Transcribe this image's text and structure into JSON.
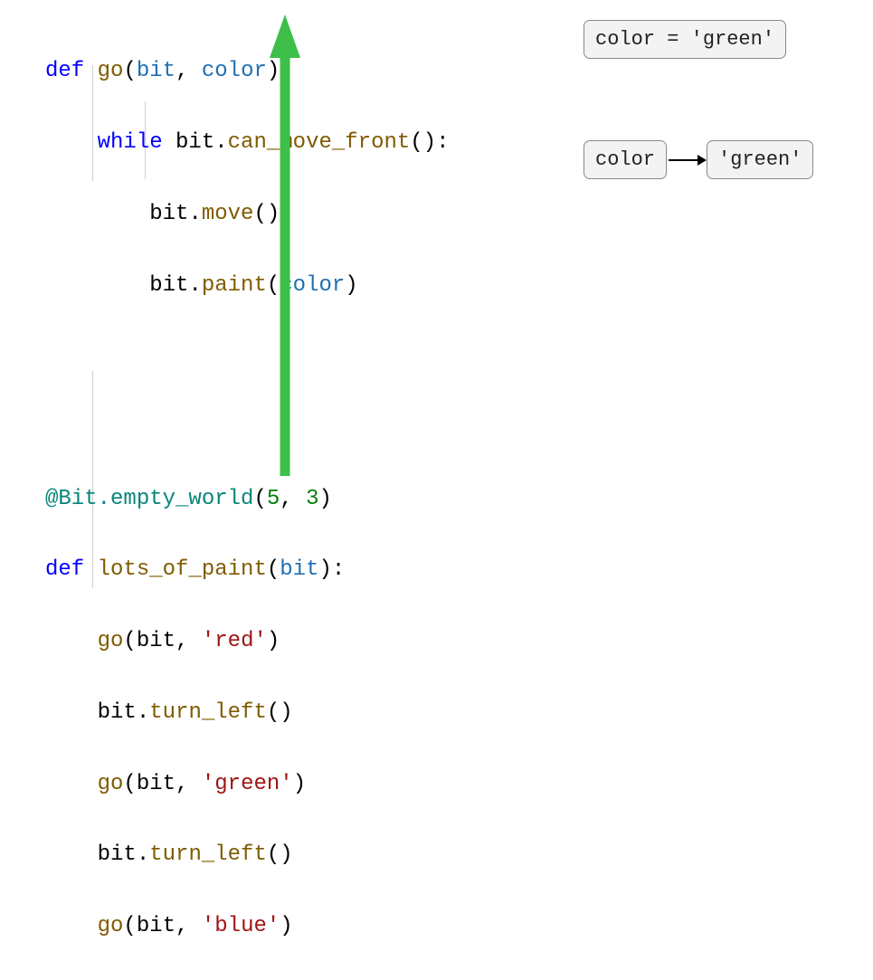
{
  "code": {
    "l1": {
      "def": "def",
      "fn": "go",
      "p1": "bit",
      "p2": "color"
    },
    "l2": {
      "kw": "while",
      "obj": "bit",
      "method": "can_move_front"
    },
    "l3": {
      "obj": "bit",
      "method": "move"
    },
    "l4": {
      "obj": "bit",
      "method": "paint",
      "arg": "color"
    },
    "l5": {
      "deco": "@Bit.empty_world",
      "n1": "5",
      "n2": "3"
    },
    "l6": {
      "def": "def",
      "fn": "lots_of_paint",
      "p1": "bit"
    },
    "l7": {
      "fn": "go",
      "a1": "bit",
      "a2": "'red'"
    },
    "l8": {
      "obj": "bit",
      "method": "turn_left"
    },
    "l9": {
      "fn": "go",
      "a1": "bit",
      "a2": "'green'"
    },
    "l10": {
      "obj": "bit",
      "method": "turn_left"
    },
    "l11": {
      "fn": "go",
      "a1": "bit",
      "a2": "'blue'"
    }
  },
  "sidebar": {
    "assignment": "color = 'green'",
    "var": "color",
    "val": "'green'"
  },
  "arrow": {
    "color": "#3dbf4a"
  }
}
